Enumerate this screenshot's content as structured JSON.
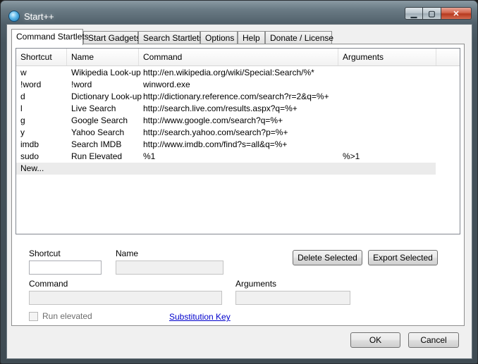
{
  "window": {
    "title": "Start++",
    "caption_min": "▁",
    "caption_max": "▢",
    "caption_close": "✕"
  },
  "tabs": [
    {
      "label": "Command Startlets",
      "active": true
    },
    {
      "label": "Start Gadgets"
    },
    {
      "label": "Search Startlets"
    },
    {
      "label": "Options"
    },
    {
      "label": "Help"
    },
    {
      "label": "Donate / License"
    }
  ],
  "list": {
    "columns": [
      "Shortcut",
      "Name",
      "Command",
      "Arguments"
    ],
    "rows": [
      {
        "shortcut": "w",
        "name": "Wikipedia Look-up",
        "command": "http://en.wikipedia.org/wiki/Special:Search/%*",
        "arguments": ""
      },
      {
        "shortcut": "!word",
        "name": "!word",
        "command": "winword.exe",
        "arguments": ""
      },
      {
        "shortcut": "d",
        "name": "Dictionary Look-up",
        "command": "http://dictionary.reference.com/search?r=2&q=%+",
        "arguments": ""
      },
      {
        "shortcut": "l",
        "name": "Live Search",
        "command": "http://search.live.com/results.aspx?q=%+",
        "arguments": ""
      },
      {
        "shortcut": "g",
        "name": "Google Search",
        "command": "http://www.google.com/search?q=%+",
        "arguments": ""
      },
      {
        "shortcut": "y",
        "name": "Yahoo Search",
        "command": "http://search.yahoo.com/search?p=%+",
        "arguments": ""
      },
      {
        "shortcut": "imdb",
        "name": "Search IMDB",
        "command": "http://www.imdb.com/find?s=all&q=%+",
        "arguments": ""
      },
      {
        "shortcut": "sudo",
        "name": "Run Elevated",
        "command": "%1",
        "arguments": "%>1"
      }
    ],
    "new_item_label": "New..."
  },
  "form": {
    "shortcut_label": "Shortcut",
    "shortcut_value": "",
    "name_label": "Name",
    "name_value": "",
    "command_label": "Command",
    "command_value": "",
    "arguments_label": "Arguments",
    "arguments_value": "",
    "run_elevated_label": "Run elevated",
    "run_elevated_checked": false,
    "substitution_key_link": "Substitution Key",
    "delete_selected_label": "Delete Selected",
    "export_selected_label": "Export Selected"
  },
  "dialog_buttons": {
    "ok_label": "OK",
    "cancel_label": "Cancel"
  }
}
